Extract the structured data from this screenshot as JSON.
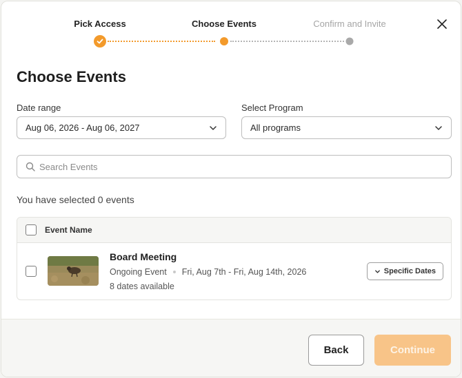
{
  "stepper": {
    "steps": [
      {
        "label": "Pick Access",
        "state": "done"
      },
      {
        "label": "Choose Events",
        "state": "current"
      },
      {
        "label": "Confirm and Invite",
        "state": "future"
      }
    ]
  },
  "title": "Choose Events",
  "filters": {
    "date_range_label": "Date range",
    "date_range_value": "Aug 06, 2026 - Aug 06, 2027",
    "program_label": "Select Program",
    "program_value": "All programs"
  },
  "search": {
    "placeholder": "Search Events"
  },
  "selected_text": "You have selected 0 events",
  "table": {
    "header": "Event Name",
    "rows": [
      {
        "name": "Board Meeting",
        "type": "Ongoing Event",
        "date_span": "Fri, Aug 7th - Fri, Aug 14th, 2026",
        "availability": "8 dates available",
        "action": "Specific Dates"
      }
    ]
  },
  "footer": {
    "back": "Back",
    "continue": "Continue"
  },
  "colors": {
    "accent": "#f39a2b",
    "continue_disabled": "#f8c488"
  },
  "icons": [
    "check-icon",
    "close-icon",
    "chevron-down-icon",
    "search-icon"
  ]
}
